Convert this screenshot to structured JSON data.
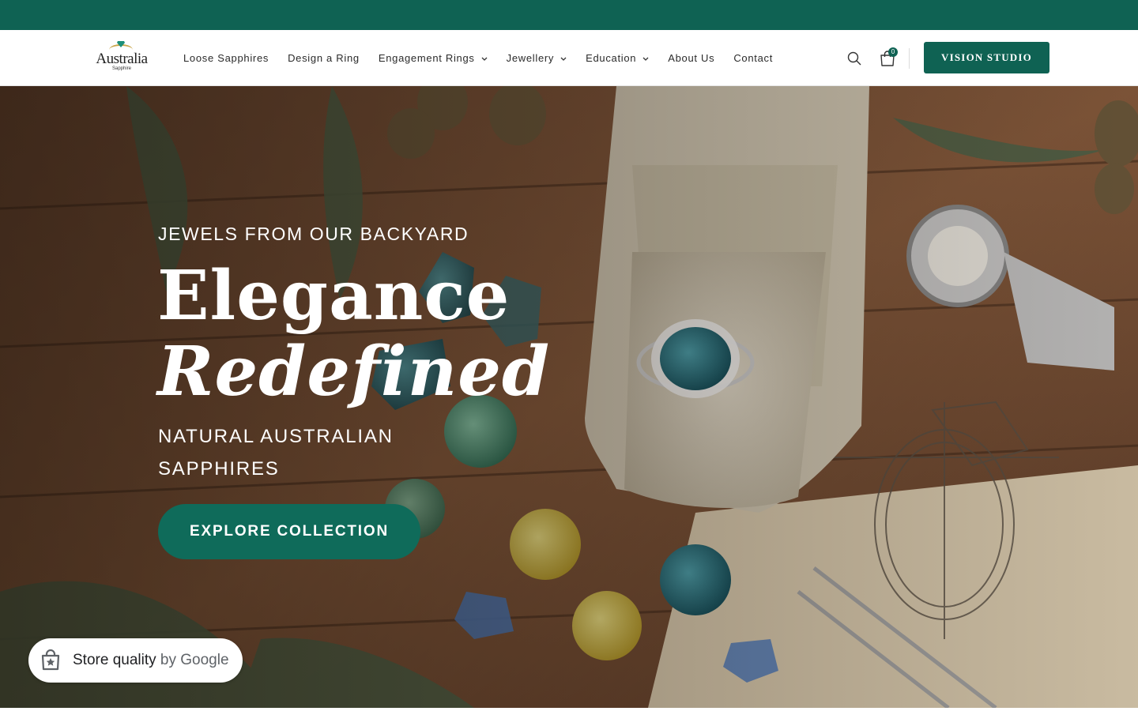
{
  "brand": {
    "logo_word": "Australia",
    "logo_sub": "Sapphire",
    "accent": "#0f6253"
  },
  "nav": {
    "items": [
      {
        "label": "Loose Sapphires",
        "dropdown": false
      },
      {
        "label": "Design a Ring",
        "dropdown": false
      },
      {
        "label": "Engagement Rings",
        "dropdown": true
      },
      {
        "label": "Jewellery",
        "dropdown": true
      },
      {
        "label": "Education",
        "dropdown": true
      },
      {
        "label": "About Us",
        "dropdown": false
      },
      {
        "label": "Contact",
        "dropdown": false
      }
    ],
    "chevron_glyph": "⌄"
  },
  "header": {
    "search_icon": "search-icon",
    "cart_icon": "shopping-bag-icon",
    "cart_count": "0",
    "cta_label": "VISION STUDIO"
  },
  "hero": {
    "eyebrow": "JEWELS FROM OUR BACKYARD",
    "headline_line1": "Elegance",
    "headline_line2": "Redefined",
    "subhead": "NATURAL AUSTRALIAN SAPPHIRES",
    "cta_label": "EXPLORE COLLECTION"
  },
  "badge": {
    "icon": "store-quality-icon",
    "label": "Store quality",
    "by": "by Google"
  }
}
